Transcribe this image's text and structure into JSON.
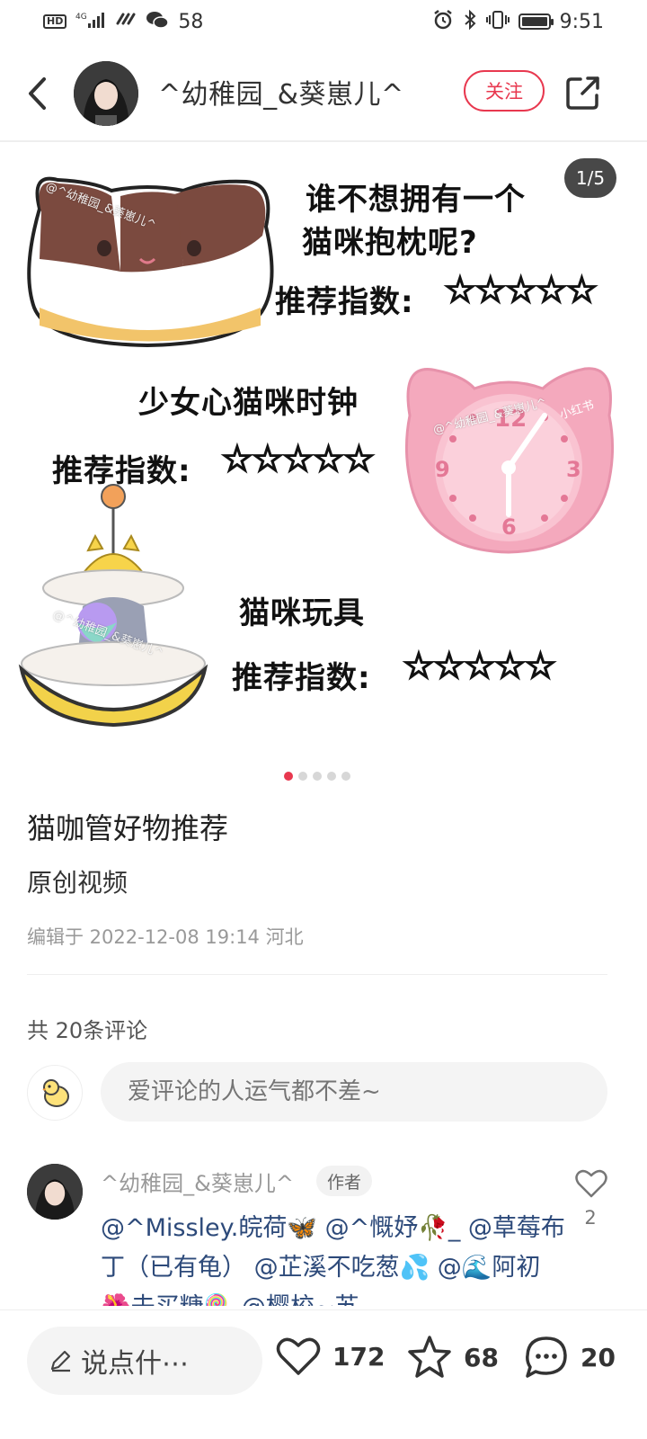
{
  "status_bar": {
    "network": "HD 4G",
    "notification_count": "58",
    "time": "9:51"
  },
  "header": {
    "username": "^幼稚园_&葵崽儿^",
    "follow_label": "关注"
  },
  "carousel": {
    "counter": "1/5",
    "current_index": 1,
    "total": 5,
    "slide": {
      "line1": "谁不想拥有一个",
      "line2": "猫咪抱枕呢?",
      "item2": "少女心猫咪时钟",
      "item3": "猫咪玩具",
      "rating_label": "推荐指数:",
      "rating_stars": "☆☆☆☆☆",
      "watermark": "@^幼稚园_&葵崽儿^",
      "brand": "小红书",
      "clock_numbers": {
        "n12": "12",
        "n3": "3",
        "n6": "6",
        "n9": "9"
      }
    }
  },
  "post": {
    "title": "猫咖管好物推荐",
    "body": "原创视频",
    "meta": "编辑于 2022-12-08 19:14 河北"
  },
  "comments": {
    "count_label": "共 20条评论",
    "input_placeholder": "爱评论的人运气都不差~",
    "items": [
      {
        "name": "^幼稚园_&葵崽儿^",
        "tag": "作者",
        "text": "@^Missley.皖荷🦋  @^慨妤🥀_  @草莓布丁（已有龟）  @芷溪不吃葱💦  @🌊阿初  🌺去买糖🍭  @樱校~苏",
        "likes": "2"
      }
    ]
  },
  "bottom_bar": {
    "input_label": "说点什⋯",
    "likes": "172",
    "favorites": "68",
    "comments": "20"
  },
  "colors": {
    "accent": "#e8384f",
    "mention": "#2d4a7a",
    "clock_pink": "#f4a9bd"
  }
}
